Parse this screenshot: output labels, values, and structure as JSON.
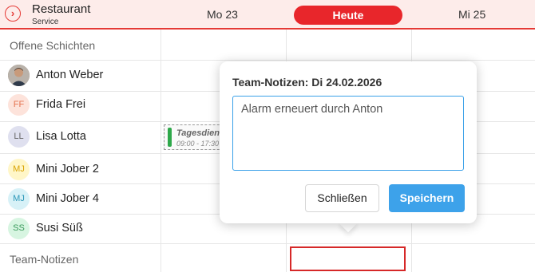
{
  "header": {
    "location_title": "Restaurant",
    "location_subtitle": "Service",
    "location_icon": "chevron-right-icon",
    "days": [
      {
        "label": "Mo 23"
      },
      {
        "label": "Heute"
      },
      {
        "label": "Mi 25"
      }
    ]
  },
  "rows": {
    "open_shifts": "Offene Schichten",
    "team_notes": "Team-Notizen"
  },
  "employees": [
    {
      "name": "Anton Weber",
      "initials": "",
      "avatar": "photo",
      "color": "#7a6a5a"
    },
    {
      "name": "Frida Frei",
      "initials": "FF",
      "color": "#fde3db",
      "text_color": "#e57350"
    },
    {
      "name": "Lisa Lotta",
      "initials": "LL",
      "color": "#dfe0ef",
      "text_color": "#666"
    },
    {
      "name": "Mini Jober 2",
      "initials": "MJ",
      "color": "#fff6c8",
      "text_color": "#d9a300"
    },
    {
      "name": "Mini Jober 4",
      "initials": "MJ",
      "color": "#d7f1f7",
      "text_color": "#2b97b8"
    },
    {
      "name": "Susi Süß",
      "initials": "SS",
      "color": "#d7f5e1",
      "text_color": "#3a9a5b"
    }
  ],
  "shift": {
    "title": "Tagesdienst",
    "time": "09:00 - 17:30",
    "color": "#2ea84a"
  },
  "popup": {
    "title": "Team-Notizen: Di 24.02.2026",
    "note_value": "Alarm erneuert durch Anton",
    "close_label": "Schließen",
    "save_label": "Speichern"
  },
  "colors": {
    "accent": "#e8262b",
    "primary_button": "#3da2ea"
  }
}
